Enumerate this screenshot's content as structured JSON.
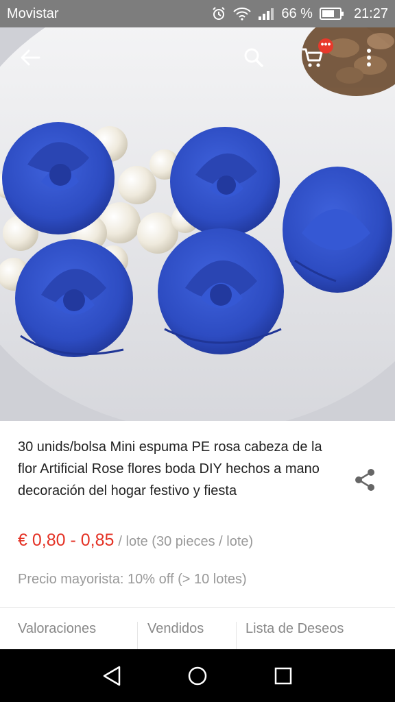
{
  "status_bar": {
    "carrier": "Movistar",
    "battery": "66 %",
    "time": "21:27"
  },
  "top_bar": {
    "icons": [
      "back-arrow-icon",
      "search-icon",
      "cart-icon",
      "more-vert-icon"
    ],
    "cart_badge": "•••"
  },
  "gallery": {
    "image_count": 6,
    "active_index": 0
  },
  "product": {
    "title": "30 unids/bolsa Mini espuma PE rosa cabeza de la flor Artificial Rose flores boda DIY hechos a mano decoración del hogar festivo y fiesta",
    "price": "€ 0,80 - 0,85",
    "price_unit": "/ lote (30 pieces / lote)",
    "wholesale": "Precio mayorista: 10% off (> 10 lotes)"
  },
  "tabs": [
    "Valoraciones",
    "Vendidos",
    "Lista de Deseos"
  ],
  "colors": {
    "accent": "#e43225",
    "status_bar": "#7d7d7d",
    "rose_blue": "#2f4fc8"
  }
}
